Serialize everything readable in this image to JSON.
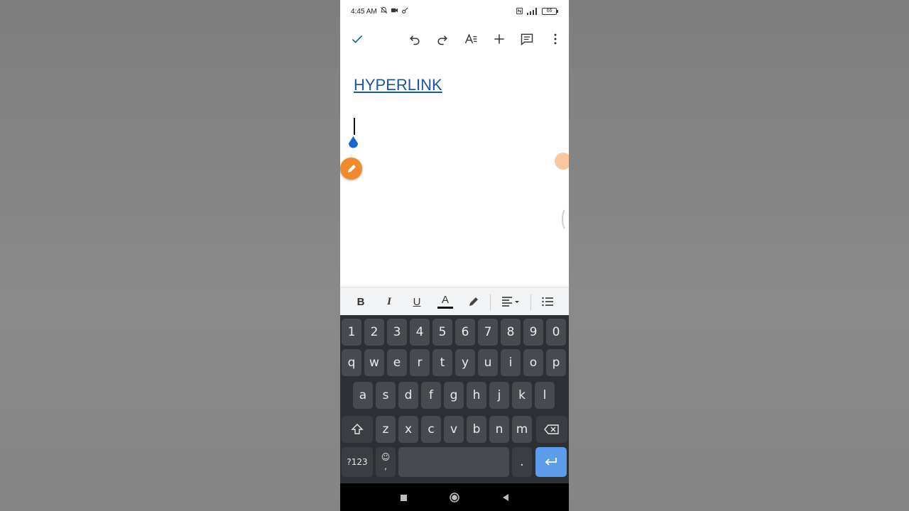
{
  "status_bar": {
    "time": "4:45 AM",
    "battery": "66"
  },
  "toolbar": {
    "done": "check-icon",
    "undo": "undo-icon",
    "redo": "redo-icon",
    "text_format": "text-format-icon",
    "insert": "plus-icon",
    "comment": "comment-icon",
    "more": "more-vert-icon"
  },
  "document": {
    "link_text": "HYPERLINK",
    "link_color": "#1a56a8"
  },
  "format_bar": {
    "bold": "B",
    "italic": "I",
    "underline": "U",
    "text_color": "A"
  },
  "keyboard": {
    "number_row": [
      "1",
      "2",
      "3",
      "4",
      "5",
      "6",
      "7",
      "8",
      "9",
      "0"
    ],
    "row1": [
      "q",
      "w",
      "e",
      "r",
      "t",
      "y",
      "u",
      "i",
      "o",
      "p"
    ],
    "row2": [
      "a",
      "s",
      "d",
      "f",
      "g",
      "h",
      "j",
      "k",
      "l"
    ],
    "row3": [
      "z",
      "x",
      "c",
      "v",
      "b",
      "n",
      "m"
    ],
    "symbols_label": "?123",
    "emoji_label": "☺",
    "comma_label": ",",
    "period_label": ".",
    "enter_color": "#5c9ce8"
  },
  "colors": {
    "accent_orange": "#f08a2c",
    "keyboard_bg": "#2c2f33",
    "key_bg": "#474b50"
  }
}
